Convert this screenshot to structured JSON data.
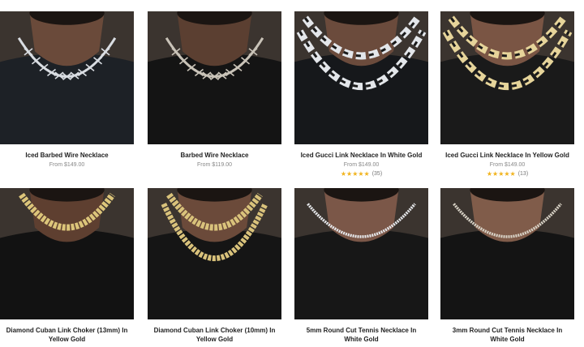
{
  "products": [
    {
      "name": "Iced Barbed Wire Necklace",
      "price": "From $149.00",
      "chain": "barbed",
      "metal": "#d9dde2",
      "shirt": "#1d2126",
      "skin": "#6a4a3a"
    },
    {
      "name": "Barbed Wire Necklace",
      "price": "From $119.00",
      "chain": "barbed",
      "metal": "#c9c3b8",
      "shirt": "#141414",
      "skin": "#5b3f31"
    },
    {
      "name": "Iced Gucci Link Necklace In White Gold",
      "price": "From $149.00",
      "rating_stars": "★★★★★",
      "rating_count": "(35)",
      "chain": "gucci",
      "metal": "#e3e6ea",
      "shirt": "#16181b",
      "skin": "#6b4b3c"
    },
    {
      "name": "Iced Gucci Link Necklace In Yellow Gold",
      "price": "From $149.00",
      "rating_stars": "★★★★★",
      "rating_count": "(13)",
      "chain": "gucci",
      "metal": "#e6d49a",
      "shirt": "#1a1a1a",
      "skin": "#7a5544"
    },
    {
      "name": "Diamond Cuban Link Choker (13mm) In Yellow Gold",
      "price": "",
      "chain": "cuban",
      "metal": "#dcc57a",
      "shirt": "#121212",
      "skin": "#5e3f30"
    },
    {
      "name": "Diamond Cuban Link Choker (10mm) In Yellow Gold",
      "price": "",
      "chain": "cuban",
      "metal": "#d9c27b",
      "shirt": "#151515",
      "skin": "#6b4a3a"
    },
    {
      "name": "5mm Round Cut Tennis Necklace In White Gold",
      "price": "",
      "chain": "tennis",
      "metal": "#e7e9ec",
      "shirt": "#171717",
      "skin": "#7b5748"
    },
    {
      "name": "3mm Round Cut Tennis Necklace In White Gold",
      "price": "",
      "chain": "tennis",
      "metal": "#d8d2c6",
      "shirt": "#141414",
      "skin": "#805c4a"
    }
  ]
}
